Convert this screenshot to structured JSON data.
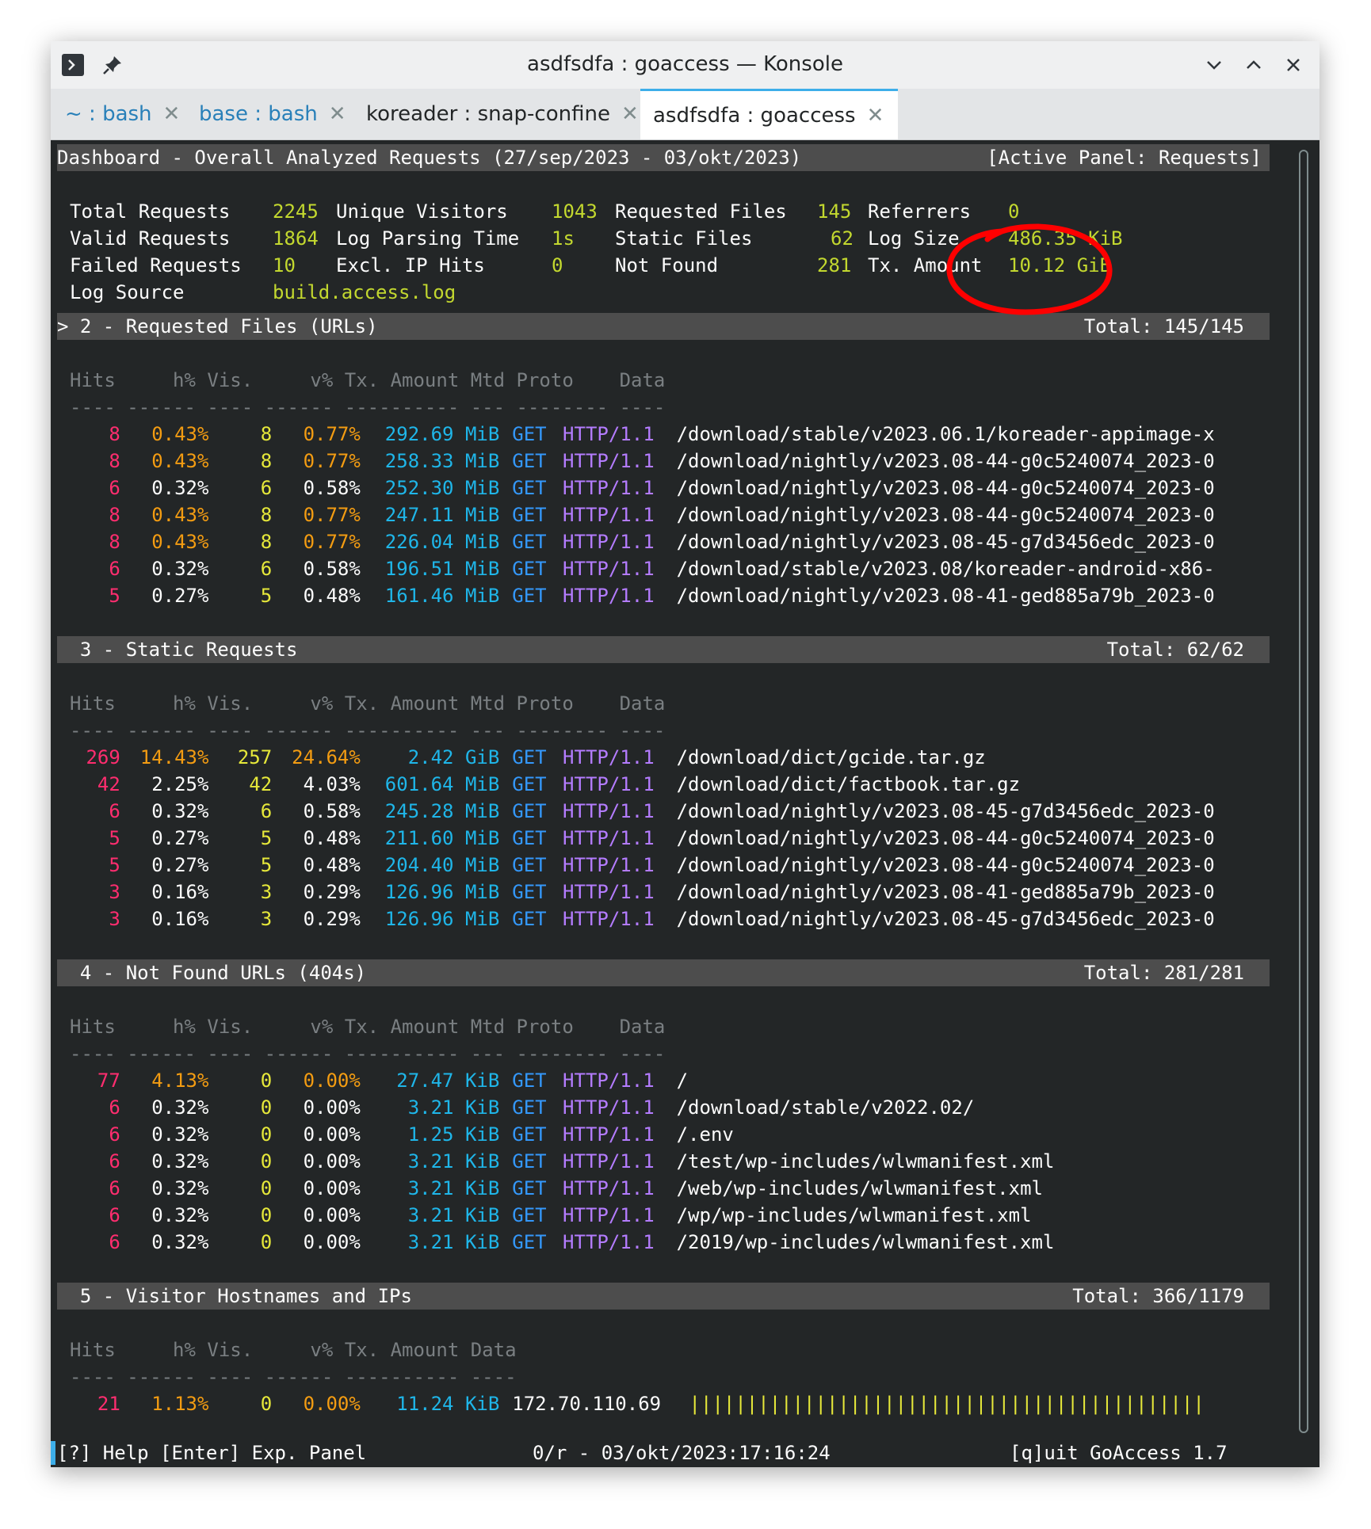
{
  "window": {
    "title": "asdfsdfa : goaccess — Konsole",
    "icons": [
      "terminal-icon",
      "pin-icon",
      "minimize-icon",
      "maximize-icon",
      "close-icon"
    ]
  },
  "tabs": [
    {
      "label": "~ : bash",
      "active": false
    },
    {
      "label": "base : bash",
      "active": false
    },
    {
      "label": "koreader : snap-confine",
      "active": false
    },
    {
      "label": "asdfsdfa : goaccess",
      "active": true
    }
  ],
  "header": {
    "title": "Dashboard - Overall Analyzed Requests (27/sep/2023 - 03/okt/2023)",
    "active_panel": "[Active Panel: Requests]"
  },
  "overview": {
    "total_requests_label": "Total Requests",
    "total_requests": "2245",
    "unique_visitors_label": "Unique Visitors",
    "unique_visitors": "1043",
    "requested_files_label": "Requested Files",
    "requested_files": "145",
    "referrers_label": "Referrers",
    "referrers": "0",
    "valid_requests_label": "Valid Requests",
    "valid_requests": "1864",
    "log_parsing_time_label": "Log Parsing Time",
    "log_parsing_time": "1s",
    "static_files_label": "Static Files",
    "static_files": "62",
    "log_size_label": "Log Size",
    "log_size": "486.35 KiB",
    "failed_requests_label": "Failed Requests",
    "failed_requests": "10",
    "excl_ip_hits_label": "Excl. IP Hits",
    "excl_ip_hits": "0",
    "not_found_label": "Not Found",
    "not_found": "281",
    "tx_amount_label": "Tx. Amount",
    "tx_amount": "10.12 GiB",
    "log_source_label": "Log Source",
    "log_source": "build.access.log"
  },
  "annotation": {
    "color": "#ff0000"
  },
  "column_header": "Hits     h% Vis.     v% Tx. Amount Mtd Proto    Data",
  "column_rule": "---- ------ ---- ------ ---------- --- -------- ----",
  "column_header_hosts": "Hits     h% Vis.     v% Tx. Amount Data",
  "column_rule_hosts": "---- ------ ---- ------ ---------- ----",
  "panels": [
    {
      "title": "> 2 - Requested Files (URLs)",
      "total": "Total: 145/145",
      "rows": [
        {
          "hits": "8",
          "hp": "0.43%",
          "vis": "8",
          "vp": "0.77%",
          "tx": "292.69 MiB",
          "mtd": "GET",
          "proto": "HTTP/1.1",
          "data": "/download/stable/v2023.06.1/koreader-appimage-x",
          "hi": true
        },
        {
          "hits": "8",
          "hp": "0.43%",
          "vis": "8",
          "vp": "0.77%",
          "tx": "258.33 MiB",
          "mtd": "GET",
          "proto": "HTTP/1.1",
          "data": "/download/nightly/v2023.08-44-g0c5240074_2023-0",
          "hi": true
        },
        {
          "hits": "6",
          "hp": "0.32%",
          "vis": "6",
          "vp": "0.58%",
          "tx": "252.30 MiB",
          "mtd": "GET",
          "proto": "HTTP/1.1",
          "data": "/download/nightly/v2023.08-44-g0c5240074_2023-0",
          "hi": false
        },
        {
          "hits": "8",
          "hp": "0.43%",
          "vis": "8",
          "vp": "0.77%",
          "tx": "247.11 MiB",
          "mtd": "GET",
          "proto": "HTTP/1.1",
          "data": "/download/nightly/v2023.08-44-g0c5240074_2023-0",
          "hi": true
        },
        {
          "hits": "8",
          "hp": "0.43%",
          "vis": "8",
          "vp": "0.77%",
          "tx": "226.04 MiB",
          "mtd": "GET",
          "proto": "HTTP/1.1",
          "data": "/download/nightly/v2023.08-45-g7d3456edc_2023-0",
          "hi": true
        },
        {
          "hits": "6",
          "hp": "0.32%",
          "vis": "6",
          "vp": "0.58%",
          "tx": "196.51 MiB",
          "mtd": "GET",
          "proto": "HTTP/1.1",
          "data": "/download/stable/v2023.08/koreader-android-x86-",
          "hi": false
        },
        {
          "hits": "5",
          "hp": "0.27%",
          "vis": "5",
          "vp": "0.48%",
          "tx": "161.46 MiB",
          "mtd": "GET",
          "proto": "HTTP/1.1",
          "data": "/download/nightly/v2023.08-41-ged885a79b_2023-0",
          "hi": false
        }
      ]
    },
    {
      "title": "  3 - Static Requests",
      "total": "Total: 62/62",
      "rows": [
        {
          "hits": "269",
          "hp": "14.43%",
          "vis": "257",
          "vp": "24.64%",
          "tx": "2.42 GiB",
          "mtd": "GET",
          "proto": "HTTP/1.1",
          "data": "/download/dict/gcide.tar.gz",
          "hi": true
        },
        {
          "hits": "42",
          "hp": "2.25%",
          "vis": "42",
          "vp": "4.03%",
          "tx": "601.64 MiB",
          "mtd": "GET",
          "proto": "HTTP/1.1",
          "data": "/download/dict/factbook.tar.gz",
          "hi": false
        },
        {
          "hits": "6",
          "hp": "0.32%",
          "vis": "6",
          "vp": "0.58%",
          "tx": "245.28 MiB",
          "mtd": "GET",
          "proto": "HTTP/1.1",
          "data": "/download/nightly/v2023.08-45-g7d3456edc_2023-0",
          "hi": false
        },
        {
          "hits": "5",
          "hp": "0.27%",
          "vis": "5",
          "vp": "0.48%",
          "tx": "211.60 MiB",
          "mtd": "GET",
          "proto": "HTTP/1.1",
          "data": "/download/nightly/v2023.08-44-g0c5240074_2023-0",
          "hi": false
        },
        {
          "hits": "5",
          "hp": "0.27%",
          "vis": "5",
          "vp": "0.48%",
          "tx": "204.40 MiB",
          "mtd": "GET",
          "proto": "HTTP/1.1",
          "data": "/download/nightly/v2023.08-44-g0c5240074_2023-0",
          "hi": false
        },
        {
          "hits": "3",
          "hp": "0.16%",
          "vis": "3",
          "vp": "0.29%",
          "tx": "126.96 MiB",
          "mtd": "GET",
          "proto": "HTTP/1.1",
          "data": "/download/nightly/v2023.08-41-ged885a79b_2023-0",
          "hi": false
        },
        {
          "hits": "3",
          "hp": "0.16%",
          "vis": "3",
          "vp": "0.29%",
          "tx": "126.96 MiB",
          "mtd": "GET",
          "proto": "HTTP/1.1",
          "data": "/download/nightly/v2023.08-45-g7d3456edc_2023-0",
          "hi": false
        }
      ]
    },
    {
      "title": "  4 - Not Found URLs (404s)",
      "total": "Total: 281/281",
      "rows": [
        {
          "hits": "77",
          "hp": "4.13%",
          "vis": "0",
          "vp": "0.00%",
          "tx": "27.47 KiB",
          "mtd": "GET",
          "proto": "HTTP/1.1",
          "data": "/",
          "hi": true
        },
        {
          "hits": "6",
          "hp": "0.32%",
          "vis": "0",
          "vp": "0.00%",
          "tx": "3.21 KiB",
          "mtd": "GET",
          "proto": "HTTP/1.1",
          "data": "/download/stable/v2022.02/",
          "hi": false
        },
        {
          "hits": "6",
          "hp": "0.32%",
          "vis": "0",
          "vp": "0.00%",
          "tx": "1.25 KiB",
          "mtd": "GET",
          "proto": "HTTP/1.1",
          "data": "/.env",
          "hi": false
        },
        {
          "hits": "6",
          "hp": "0.32%",
          "vis": "0",
          "vp": "0.00%",
          "tx": "3.21 KiB",
          "mtd": "GET",
          "proto": "HTTP/1.1",
          "data": "/test/wp-includes/wlwmanifest.xml",
          "hi": false
        },
        {
          "hits": "6",
          "hp": "0.32%",
          "vis": "0",
          "vp": "0.00%",
          "tx": "3.21 KiB",
          "mtd": "GET",
          "proto": "HTTP/1.1",
          "data": "/web/wp-includes/wlwmanifest.xml",
          "hi": false
        },
        {
          "hits": "6",
          "hp": "0.32%",
          "vis": "0",
          "vp": "0.00%",
          "tx": "3.21 KiB",
          "mtd": "GET",
          "proto": "HTTP/1.1",
          "data": "/wp/wp-includes/wlwmanifest.xml",
          "hi": false
        },
        {
          "hits": "6",
          "hp": "0.32%",
          "vis": "0",
          "vp": "0.00%",
          "tx": "3.21 KiB",
          "mtd": "GET",
          "proto": "HTTP/1.1",
          "data": "/2019/wp-includes/wlwmanifest.xml",
          "hi": false
        }
      ]
    }
  ],
  "hosts_panel": {
    "title": "  5 - Visitor Hostnames and IPs",
    "total": "Total: 366/1179",
    "row": {
      "hits": "21",
      "hp": "1.13%",
      "vis": "0",
      "vp": "0.00%",
      "tx": "11.24 KiB",
      "data": "172.70.110.69",
      "bar": "|||||||||||||||||||||||||||||||||||||||||||||"
    }
  },
  "status_bar": {
    "left": "[?] Help [Enter] Exp. Panel",
    "middle": "0/r - 03/okt/2023:17:16:24",
    "right": "[q]uit GoAccess 1.7"
  }
}
